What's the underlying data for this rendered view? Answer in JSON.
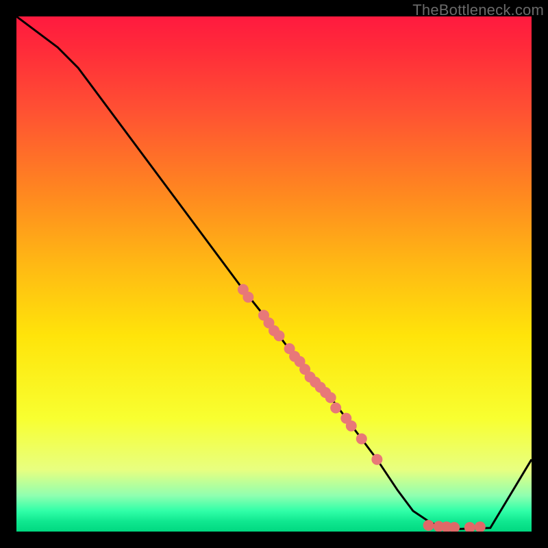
{
  "watermark": "TheBottleneck.com",
  "chart_data": {
    "type": "line",
    "title": "",
    "xlabel": "",
    "ylabel": "",
    "xlim": [
      0,
      100
    ],
    "ylim": [
      0,
      100
    ],
    "grid": false,
    "curve": {
      "x": [
        0,
        8,
        12,
        44,
        48,
        54,
        58,
        61,
        64,
        67,
        70,
        74,
        77,
        80,
        82,
        86,
        92,
        100
      ],
      "y": [
        100,
        94,
        90,
        47,
        42,
        34,
        29,
        26,
        22,
        18,
        14,
        8,
        4,
        2,
        1,
        0.5,
        0.7,
        14
      ]
    },
    "series": [
      {
        "name": "markers-upper",
        "type": "scatter",
        "color": "#e87878",
        "points": [
          {
            "x": 44,
            "y": 47
          },
          {
            "x": 45,
            "y": 45.5
          },
          {
            "x": 48,
            "y": 42
          },
          {
            "x": 49,
            "y": 40.5
          },
          {
            "x": 50,
            "y": 39
          },
          {
            "x": 51,
            "y": 38
          },
          {
            "x": 53,
            "y": 35.5
          },
          {
            "x": 54,
            "y": 34
          },
          {
            "x": 55,
            "y": 33
          },
          {
            "x": 56,
            "y": 31.5
          },
          {
            "x": 57,
            "y": 30
          },
          {
            "x": 58,
            "y": 29
          },
          {
            "x": 59,
            "y": 28
          },
          {
            "x": 60,
            "y": 27
          },
          {
            "x": 61,
            "y": 26
          },
          {
            "x": 62,
            "y": 24
          },
          {
            "x": 64,
            "y": 22
          },
          {
            "x": 65,
            "y": 20.5
          },
          {
            "x": 67,
            "y": 18
          },
          {
            "x": 70,
            "y": 14
          }
        ]
      },
      {
        "name": "markers-lower",
        "type": "scatter",
        "color": "#e06868",
        "points": [
          {
            "x": 80,
            "y": 1.2
          },
          {
            "x": 82,
            "y": 1.0
          },
          {
            "x": 83.5,
            "y": 0.9
          },
          {
            "x": 85,
            "y": 0.8
          },
          {
            "x": 88,
            "y": 0.8
          },
          {
            "x": 90,
            "y": 0.9
          }
        ]
      }
    ]
  }
}
